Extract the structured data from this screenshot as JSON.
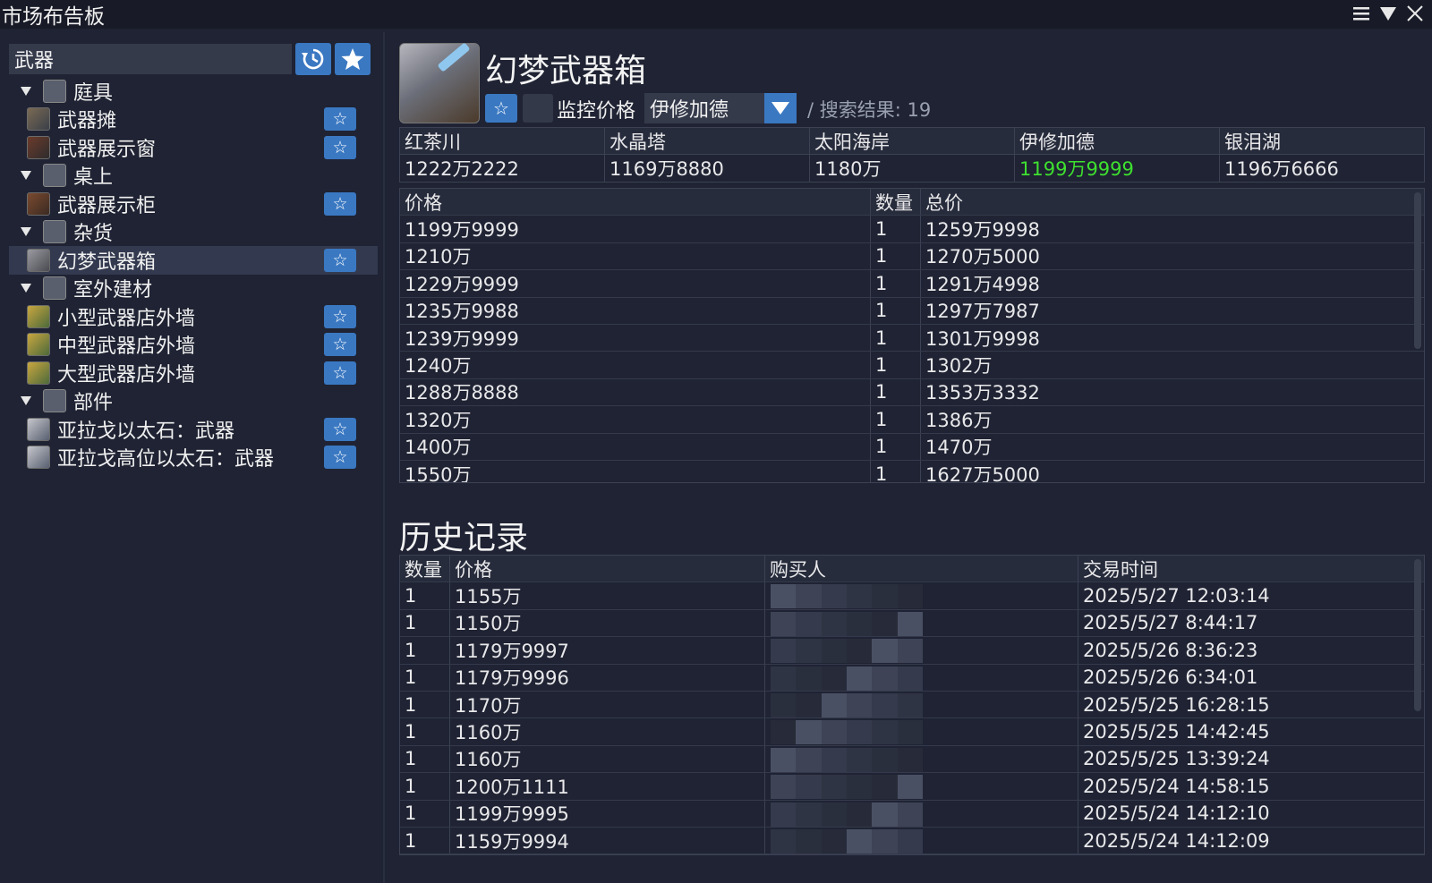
{
  "window": {
    "title": "市场布告板"
  },
  "search": {
    "value": "武器"
  },
  "tree": [
    {
      "type": "cat",
      "label": "庭具"
    },
    {
      "type": "item",
      "label": "武器摊",
      "icon": "stall"
    },
    {
      "type": "item",
      "label": "武器展示窗",
      "icon": "window"
    },
    {
      "type": "cat",
      "label": "桌上"
    },
    {
      "type": "item",
      "label": "武器展示柜",
      "icon": "cabinet"
    },
    {
      "type": "cat",
      "label": "杂货"
    },
    {
      "type": "item",
      "label": "幻梦武器箱",
      "icon": "box",
      "selected": true
    },
    {
      "type": "cat",
      "label": "室外建材"
    },
    {
      "type": "item",
      "label": "小型武器店外墙",
      "icon": "wall"
    },
    {
      "type": "item",
      "label": "中型武器店外墙",
      "icon": "wall"
    },
    {
      "type": "item",
      "label": "大型武器店外墙",
      "icon": "wall"
    },
    {
      "type": "cat",
      "label": "部件"
    },
    {
      "type": "item",
      "label": "亚拉戈以太石：武器",
      "icon": "stone"
    },
    {
      "type": "item",
      "label": "亚拉戈高位以太石：武器",
      "icon": "stone"
    }
  ],
  "item": {
    "title": "幻梦武器箱",
    "watch_label": "监控价格",
    "world": "伊修加德",
    "result_text": "/  搜索结果: 19"
  },
  "worlds": {
    "names": [
      "红茶川",
      "水晶塔",
      "太阳海岸",
      "伊修加德",
      "银泪湖"
    ],
    "prices": [
      "1222万2222",
      "1169万8880",
      "1180万",
      "1199万9999",
      "1196万6666"
    ],
    "highlight_index": 3,
    "highlight_color": "#3ee02f"
  },
  "listing": {
    "headers": [
      "价格",
      "数量",
      "总价"
    ],
    "rows": [
      [
        "1199万9999",
        "1",
        "1259万9998"
      ],
      [
        "1210万",
        "1",
        "1270万5000"
      ],
      [
        "1229万9999",
        "1",
        "1291万4998"
      ],
      [
        "1235万9988",
        "1",
        "1297万7987"
      ],
      [
        "1239万9999",
        "1",
        "1301万9998"
      ],
      [
        "1240万",
        "1",
        "1302万"
      ],
      [
        "1288万8888",
        "1",
        "1353万3332"
      ],
      [
        "1320万",
        "1",
        "1386万"
      ],
      [
        "1400万",
        "1",
        "1470万"
      ],
      [
        "1550万",
        "1",
        "1627万5000"
      ]
    ]
  },
  "history": {
    "title": "历史记录",
    "headers": [
      "数量",
      "价格",
      "购买人",
      "交易时间"
    ],
    "rows": [
      [
        "1",
        "1155万",
        "2025/5/27 12:03:14"
      ],
      [
        "1",
        "1150万",
        "2025/5/27 8:44:17"
      ],
      [
        "1",
        "1179万9997",
        "2025/5/26 8:36:23"
      ],
      [
        "1",
        "1179万9996",
        "2025/5/26 6:34:01"
      ],
      [
        "1",
        "1170万",
        "2025/5/25 16:28:15"
      ],
      [
        "1",
        "1160万",
        "2025/5/25 14:42:45"
      ],
      [
        "1",
        "1160万",
        "2025/5/25 13:39:24"
      ],
      [
        "1",
        "1200万1111",
        "2025/5/24 14:58:15"
      ],
      [
        "1",
        "1199万9995",
        "2025/5/24 14:12:10"
      ],
      [
        "1",
        "1159万9994",
        "2025/5/24 14:12:09"
      ]
    ]
  },
  "colors": {
    "accent": "#3a78c2",
    "background": "#1f2333",
    "panel": "#353a4b"
  }
}
